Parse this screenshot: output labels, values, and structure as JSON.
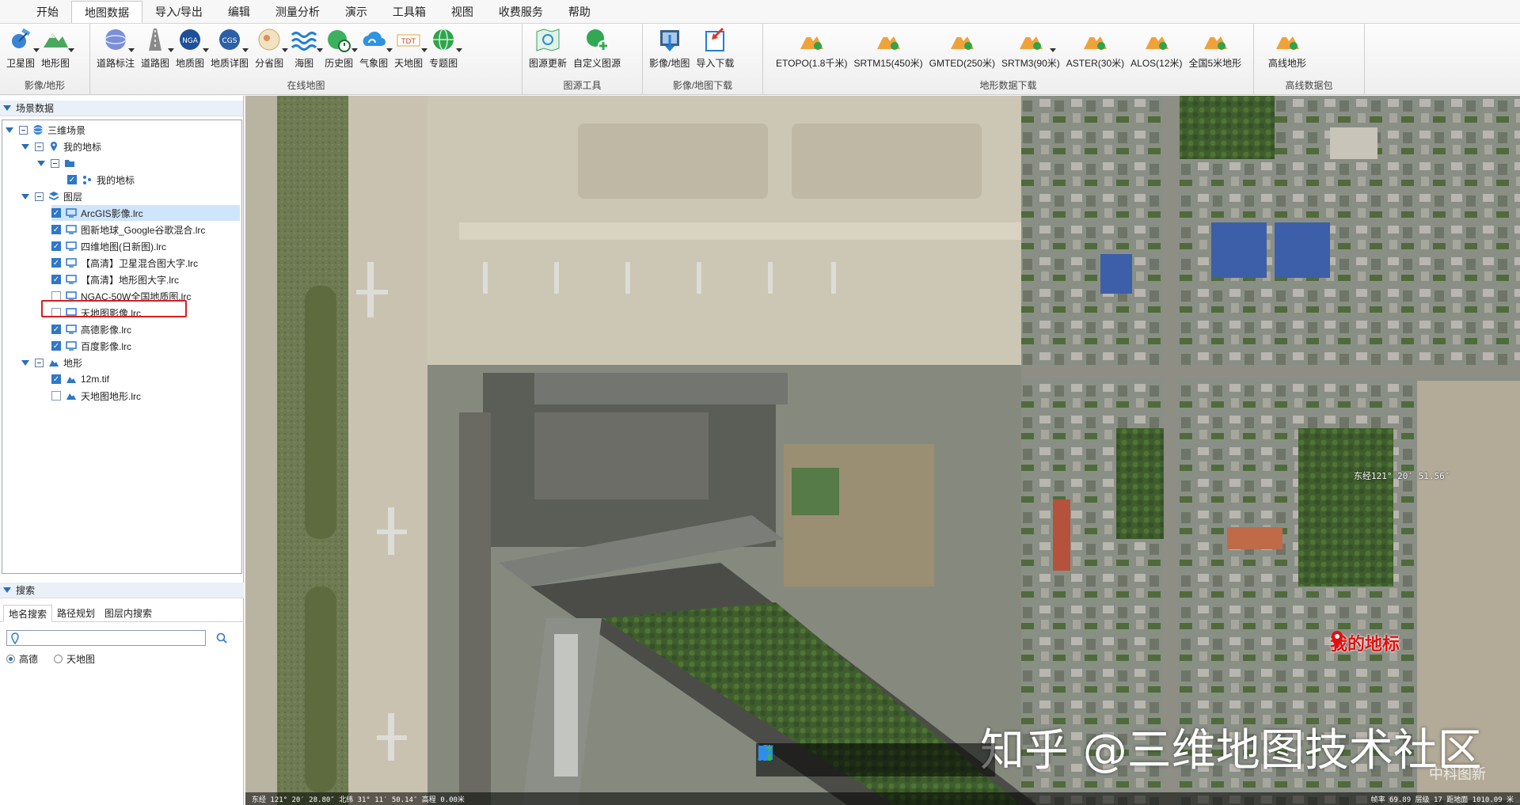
{
  "menu": {
    "tabs": [
      "开始",
      "地图数据",
      "导入/导出",
      "编辑",
      "测量分析",
      "演示",
      "工具箱",
      "视图",
      "收费服务",
      "帮助"
    ],
    "active": "地图数据"
  },
  "ribbon": {
    "groups": [
      {
        "title": "影像/地形",
        "buttons": [
          "卫星图",
          "地形图"
        ]
      },
      {
        "title": "在线地图",
        "buttons": [
          "道路标注",
          "道路图",
          "地质图",
          "地质详图",
          "分省图",
          "海图",
          "历史图",
          "气象图",
          "天地图",
          "专题图"
        ]
      },
      {
        "title": "图源工具",
        "buttons": [
          "图源更新",
          "自定义图源"
        ]
      },
      {
        "title": "影像/地图下载",
        "buttons": [
          "影像/地图",
          "导入下载"
        ]
      },
      {
        "title": "地形数据下载",
        "buttons": [
          "ETOPO(1.8千米)",
          "SRTM15(450米)",
          "GMTED(250米)",
          "SRTM3(90米)",
          "ASTER(30米)",
          "ALOS(12米)",
          "全国5米地形"
        ]
      },
      {
        "title": "高线数据包",
        "buttons": [
          "高线地形"
        ]
      }
    ]
  },
  "scene_panel": {
    "title": "场景数据",
    "tree": {
      "root": "三维场景",
      "my_places": "我的地标",
      "my_places_item": "我的地标",
      "layers": "图层",
      "layer_items": [
        {
          "label": "ArcGIS影像.lrc",
          "checked": true,
          "selected": true
        },
        {
          "label": "图新地球_Google谷歌混合.lrc",
          "checked": true
        },
        {
          "label": "四维地图(日新图).lrc",
          "checked": true
        },
        {
          "label": "【高清】卫星混合图大字.lrc",
          "checked": true
        },
        {
          "label": "【高清】地形图大字.lrc",
          "checked": true
        },
        {
          "label": "NGAC-50W全国地质图.lrc",
          "checked": false
        },
        {
          "label": "天地图影像.lrc",
          "checked": false
        },
        {
          "label": "高德影像.lrc",
          "checked": true
        },
        {
          "label": "百度影像.lrc",
          "checked": true
        }
      ],
      "terrain": "地形",
      "terrain_items": [
        {
          "label": "12m.tif",
          "checked": true
        },
        {
          "label": "天地图地形.lrc",
          "checked": false
        }
      ]
    }
  },
  "search_panel": {
    "title": "搜索",
    "tabs": [
      "地名搜索",
      "路径规划",
      "图层内搜索"
    ],
    "active_tab": "地名搜索",
    "input_value": "",
    "options": [
      "高德",
      "天地图"
    ],
    "selected_option": "高德"
  },
  "map": {
    "placemark_label": "我的地标",
    "lon_label": "东经121° 20′ 51.56″",
    "coords_left": "东经 121° 20′ 28.80″  北纬 31° 11′ 50.14″  高程 0.00米",
    "coords_right": "帧率 69.89   层级 17   距地面 1010.09 米",
    "watermark": "知乎 @三维地图技术社区",
    "brand": "中科图新",
    "tools": [
      "pan-tool",
      "select-tool",
      "placemark-tool",
      "line-tool",
      "polygon-tool",
      "chart-tool"
    ]
  }
}
